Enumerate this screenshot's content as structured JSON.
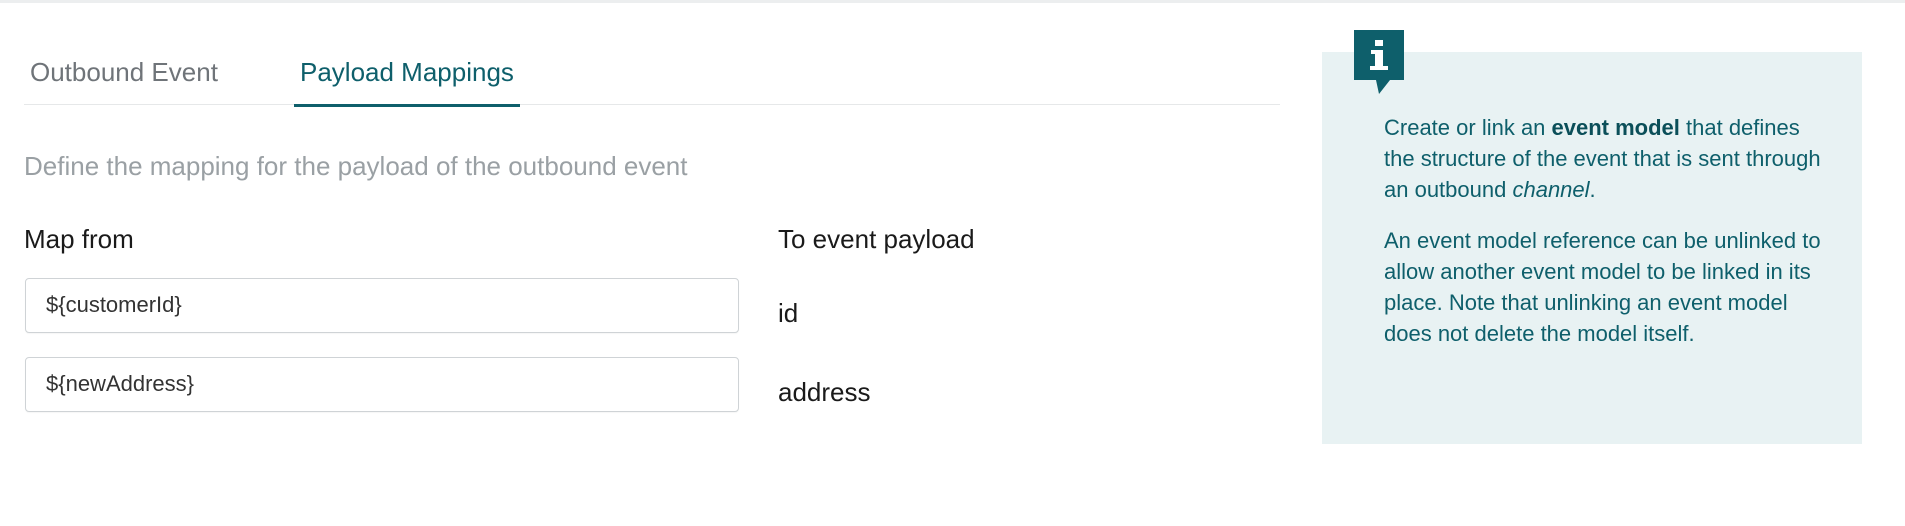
{
  "tabs": [
    {
      "label": "Outbound Event",
      "active": false
    },
    {
      "label": "Payload Mappings",
      "active": true
    }
  ],
  "description": "Define the mapping for the payload of the outbound event",
  "columns": {
    "from": "Map from",
    "to": "To event payload"
  },
  "mappings": [
    {
      "from_value": "${customerId}",
      "to": "id"
    },
    {
      "from_value": "${newAddress}",
      "to": "address"
    }
  ],
  "info": {
    "icon": "info-icon",
    "p1": {
      "before": "Create or link an ",
      "bold": "event model",
      "middle": " that defines the structure of the event that is sent through an outbound ",
      "italic": "channel",
      "after": "."
    },
    "p2": "An event model reference can be unlinked to allow another event model to be linked in its place. Note that unlinking an event model does not delete the model itself."
  },
  "colors": {
    "accent": "#0e5f6b",
    "panel_bg": "#e8f2f3",
    "muted_text": "#9aa0a4"
  }
}
